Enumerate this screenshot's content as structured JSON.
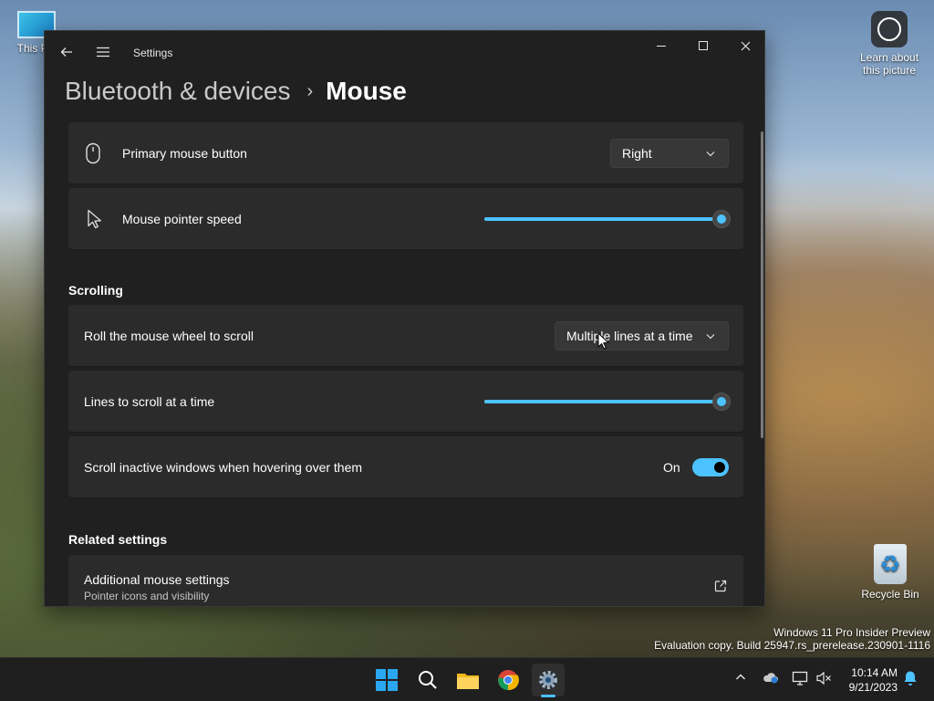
{
  "desktop": {
    "icons": {
      "this_pc": "This PC",
      "learn_picture": "Learn about this picture",
      "recycle_bin": "Recycle Bin"
    },
    "watermark": {
      "line1": "Windows 11 Pro Insider Preview",
      "line2": "Evaluation copy. Build 25947.rs_prerelease.230901-1116"
    }
  },
  "window": {
    "title": "Settings",
    "breadcrumb": {
      "parent": "Bluetooth & devices",
      "separator": "›",
      "current": "Mouse"
    }
  },
  "settings": {
    "primary_button": {
      "label": "Primary mouse button",
      "value": "Right"
    },
    "pointer_speed": {
      "label": "Mouse pointer speed",
      "value_fraction": 1.0
    },
    "scrolling_section": "Scrolling",
    "roll_wheel": {
      "label": "Roll the mouse wheel to scroll",
      "value": "Multiple lines at a time"
    },
    "lines_to_scroll": {
      "label": "Lines to scroll at a time",
      "value_fraction": 1.0
    },
    "scroll_inactive": {
      "label": "Scroll inactive windows when hovering over them",
      "state_label": "On",
      "enabled": true
    },
    "related_section": "Related settings",
    "additional_mouse": {
      "label": "Additional mouse settings",
      "sublabel": "Pointer icons and visibility"
    }
  },
  "taskbar": {
    "clock_time": "10:14 AM",
    "clock_date": "9/21/2023"
  },
  "colors": {
    "accent": "#4cc2ff",
    "card": "#2b2b2b",
    "window_bg": "#202020"
  }
}
